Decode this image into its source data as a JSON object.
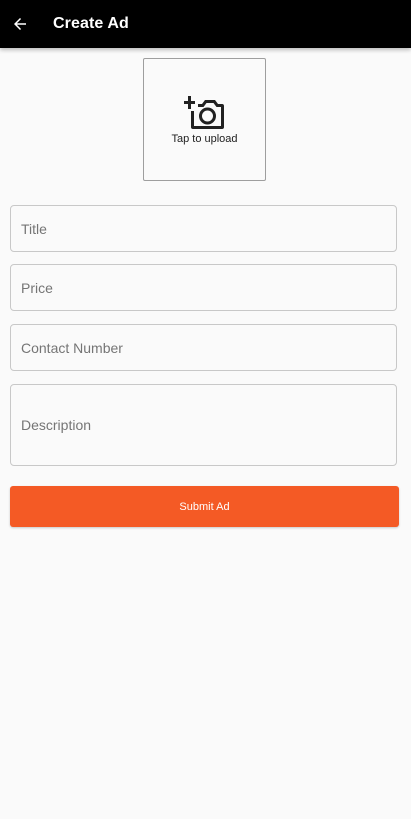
{
  "appbar": {
    "title": "Create Ad",
    "back_icon": "arrow-back-icon",
    "background": "#000000"
  },
  "upload": {
    "icon": "add-a-photo-icon",
    "label": "Tap to upload"
  },
  "form": {
    "title": {
      "placeholder": "Title",
      "value": ""
    },
    "price": {
      "placeholder": "Price",
      "value": ""
    },
    "contact": {
      "placeholder": "Contact Number",
      "value": ""
    },
    "description": {
      "placeholder": "Description",
      "value": ""
    }
  },
  "submit": {
    "label": "Submit Ad",
    "color": "#f45a25"
  }
}
